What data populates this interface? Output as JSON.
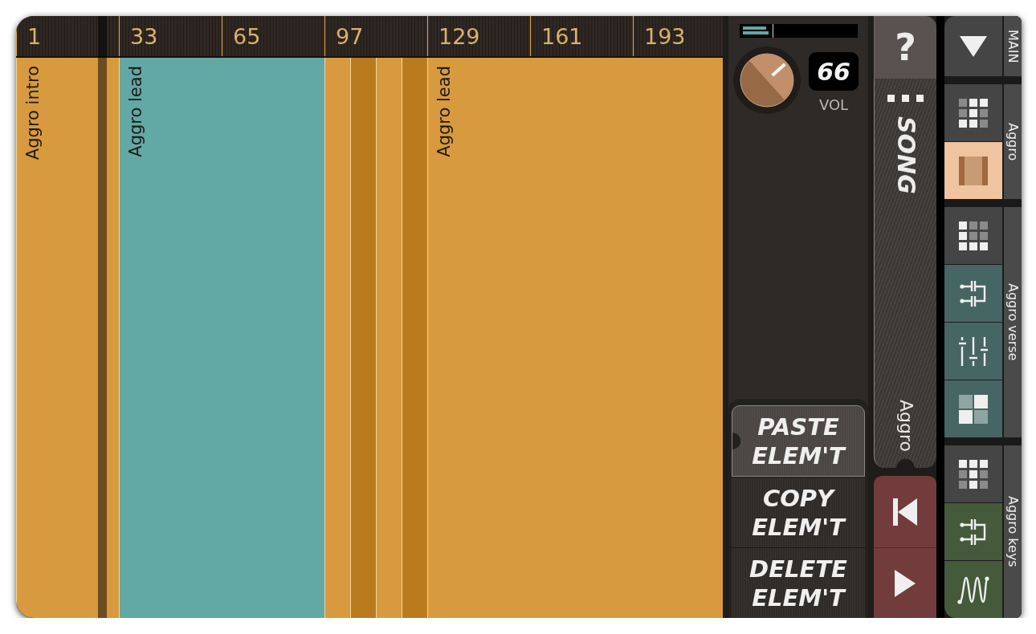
{
  "timeline": {
    "ruler": [
      "1",
      "33",
      "65",
      "97",
      "129",
      "161",
      "193"
    ],
    "playhead": {
      "level": 0.116
    },
    "segments": [
      {
        "label": "Aggro intro",
        "color": "#d89a3e"
      },
      {
        "label": "Aggro lead",
        "color": "#62a8a5"
      },
      {
        "color": "#d89a3e"
      },
      {
        "color": "#ba7b1f"
      },
      {
        "color": "#d89a3e"
      },
      {
        "color": "#ba7b1f"
      },
      {
        "label": "Aggro lead",
        "color": "#d89a3e"
      }
    ]
  },
  "mixer": {
    "meter": {
      "channels": [
        {
          "level": 0.21
        },
        {
          "level": 0.23
        }
      ]
    },
    "volume": {
      "level": 0.66,
      "value": "66",
      "label": "VOL"
    }
  },
  "edit_buttons": [
    {
      "label": "PASTE ELEM'T",
      "selected": true
    },
    {
      "label": "COPY ELEM'T",
      "selected": false
    },
    {
      "label": "DELETE ELEM'T",
      "selected": false
    }
  ],
  "song": {
    "help": "?",
    "title": "SONG",
    "pattern": "Aggro"
  },
  "transport": [
    {
      "kind": "rewind"
    },
    {
      "kind": "play"
    }
  ],
  "tracks": [
    {
      "label": "MAIN",
      "buttons": [
        {
          "kind": "menu"
        }
      ]
    },
    {
      "label": "Aggro",
      "color": "#f0c49e",
      "buttons": [
        {
          "kind": "grid"
        },
        {
          "kind": "pattern"
        }
      ]
    },
    {
      "label": "Aggro verse",
      "color": "#466664",
      "buttons": [
        {
          "kind": "grid"
        },
        {
          "kind": "routing"
        },
        {
          "kind": "mixer"
        },
        {
          "kind": "blocks"
        }
      ]
    },
    {
      "label": "Aggro keys",
      "color": "#455a3b",
      "buttons": [
        {
          "kind": "grid"
        },
        {
          "kind": "routing"
        },
        {
          "kind": "wave"
        }
      ]
    }
  ]
}
